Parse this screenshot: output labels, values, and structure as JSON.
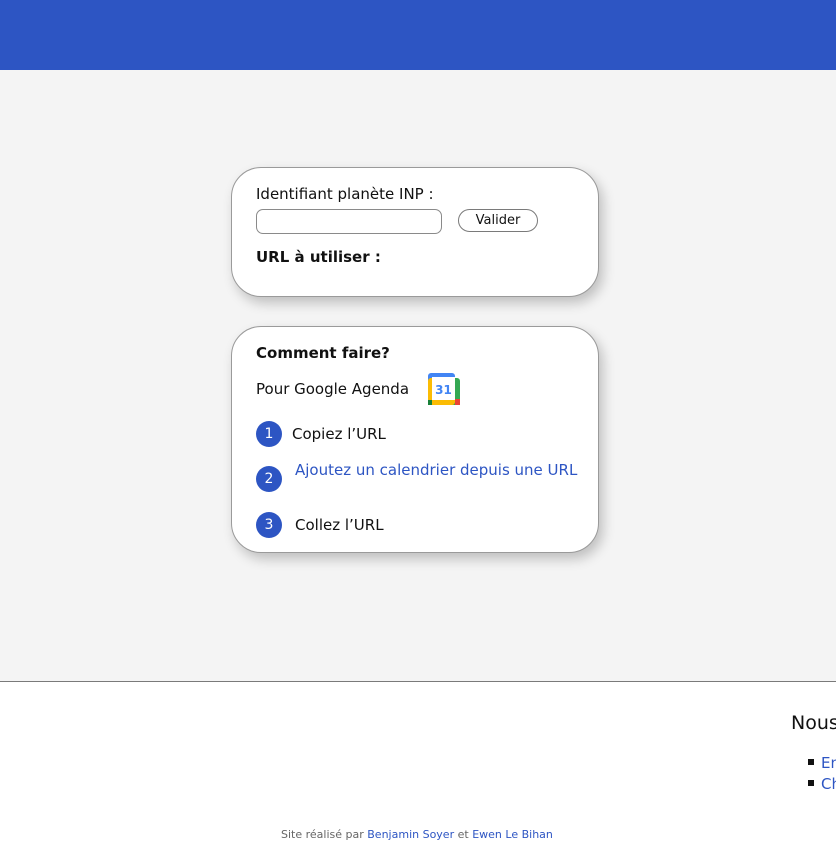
{
  "id_form": {
    "label": "Identifiant planète INP :",
    "input_value": "",
    "validate_label": "Valider",
    "url_label": "URL à utiliser :"
  },
  "howto": {
    "title": "Comment faire?",
    "google_label": "Pour Google Agenda",
    "google_icon": "google-calendar-icon",
    "calendar_day": "31",
    "steps": [
      {
        "number": "1",
        "text": "Copiez l’URL"
      },
      {
        "number": "2",
        "text": "Ajoutez un calendrier depuis une URL"
      },
      {
        "number": "3",
        "text": "Collez l’URL"
      }
    ]
  },
  "footer": {
    "contact_title": "Nous",
    "contact_links": [
      "En",
      "Ch"
    ],
    "credits_prefix": "Site réalisé par",
    "author1": "Benjamin Soyer",
    "credits_and": "et",
    "author2": "Ewen Le Bihan"
  },
  "colors": {
    "primary": "#2d55c3",
    "background": "#f4f4f4"
  }
}
